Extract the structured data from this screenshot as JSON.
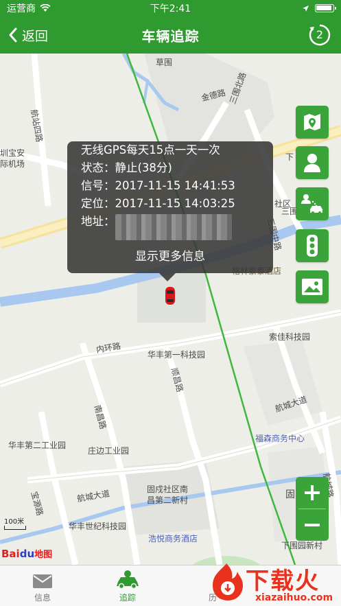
{
  "status_bar": {
    "carrier": "运营商",
    "time": "下午2:41",
    "battery_level": 0.95
  },
  "nav": {
    "back_label": "返回",
    "title": "车辆追踪",
    "refresh_count": "2"
  },
  "popup": {
    "line1": "无线GPS每天15点一天一次",
    "status_label": "状态：",
    "status_value": "静止(38分)",
    "signal_label": "信号：",
    "signal_value": "2017-11-15 14:41:53",
    "locate_label": "定位：",
    "locate_value": "2017-11-15 14:03:25",
    "address_label": "地址：",
    "more_label": "显示更多信息"
  },
  "map_labels": {
    "caowei": "草围",
    "jinde": "金德路",
    "sanweibei": "三围北路",
    "hangzhan": "航站四路",
    "shenzhen_airport_1": "圳宝安",
    "shenzhen_airport_2": "际机场",
    "shequ": "社区",
    "xia": "下",
    "sanwei": "三围",
    "sanweizhong": "三围中路",
    "gelin": "格林豪泰酒店",
    "dadao": "大",
    "suojia": "索佳科技园",
    "neihuan": "内环路",
    "huafeng1": "华丰第一科技园",
    "shunchang": "顺昌路",
    "hangcheng1": "航城大道",
    "fusen": "福森商务中心",
    "nanchang": "南昌路",
    "huafeng2": "华丰第二工业园",
    "zhuangbian": "庄边工业园",
    "gushu1": "固戍社区南",
    "gushu2": "昌第二新村",
    "hangcheng2": "航城大道",
    "baoyuan": "宝源路",
    "gu": "固",
    "huafeng_century": "华丰世纪科技园",
    "haoyue": "浩悦商务酒店",
    "xiawei": "下围园新村",
    "hangcheng_road": "航城路"
  },
  "scale_label": "100米",
  "baidu_logo": {
    "bai": "Bai",
    "du": "du",
    "map": "地图"
  },
  "tabs": [
    {
      "label": "信息",
      "icon": "mail-icon"
    },
    {
      "label": "追踪",
      "icon": "car-icon"
    },
    {
      "label": "历",
      "icon": "history-icon"
    },
    {
      "label": "",
      "icon": "more-icon"
    }
  ],
  "watermark": {
    "big": "下载火",
    "small": "xiazaihuo.com"
  },
  "colors": {
    "primary": "#2f9a2f",
    "button": "#3aa33a",
    "car": "#d8191c",
    "watermark": "#e8321d"
  }
}
